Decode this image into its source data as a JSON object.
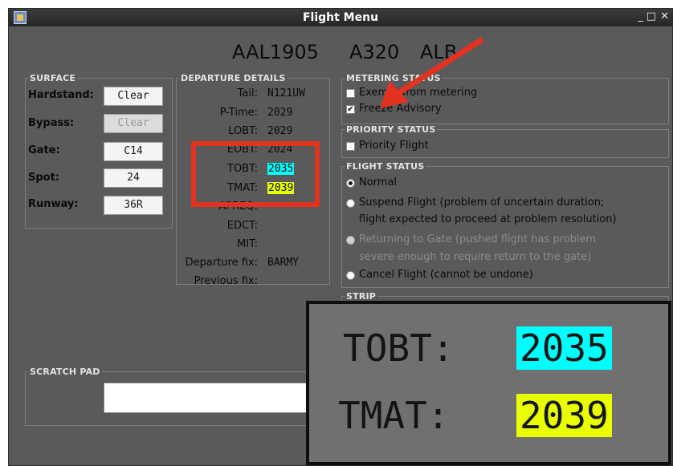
{
  "window": {
    "title": "Flight Menu",
    "minimize": "_",
    "maximize": "□",
    "close": "✕"
  },
  "header": {
    "callsign": "AAL1905",
    "aircraft": "A320",
    "extra": "ALB"
  },
  "surface": {
    "legend": "SURFACE",
    "hardstand_label": "Hardstand:",
    "hardstand_value": "Clear",
    "bypass_label": "Bypass:",
    "bypass_value": "Clear",
    "gate_label": "Gate:",
    "gate_value": "C14",
    "spot_label": "Spot:",
    "spot_value": "24",
    "runway_label": "Runway:",
    "runway_value": "36R"
  },
  "departure": {
    "legend": "DEPARTURE DETAILS",
    "tail_label": "Tail:",
    "tail_value": "N121UW",
    "ptime_label": "P-Time:",
    "ptime_value": "2029",
    "lobt_label": "LOBT:",
    "lobt_value": "2029",
    "eobt_label": "EOBT:",
    "eobt_value": "2024",
    "tobt_label": "TOBT:",
    "tobt_value": "2035",
    "tmat_label": "TMAT:",
    "tmat_value": "2039",
    "apreq_label": "APREQ:",
    "edct_label": "EDCT:",
    "mit_label": "MIT:",
    "depfix_label": "Departure fix:",
    "depfix_value": "BARMY",
    "prevfix_label": "Previous fix:"
  },
  "metering": {
    "legend": "METERING STATUS",
    "exempt_label": "Exempt from metering",
    "freeze_label": "Freeze Advisory",
    "freeze_checked": true
  },
  "priority": {
    "legend": "PRIORITY STATUS",
    "priority_label": "Priority Flight"
  },
  "flight_status": {
    "legend": "FLIGHT STATUS",
    "normal": "Normal",
    "suspend_1": "Suspend Flight (problem of uncertain duration;",
    "suspend_2": "flight expected to proceed at problem resolution)",
    "returning_1": "Returning to Gate (pushed flight has problem",
    "returning_2": "severe enough to require return to the gate)",
    "cancel": "Cancel Flight (cannot be undone)"
  },
  "strip": {
    "legend": "STRIP"
  },
  "scratch": {
    "legend": "SCRATCH PAD",
    "value": ""
  },
  "zoom_inset": {
    "tobt_label": "TOBT:",
    "tobt_value": "2035",
    "tmat_label": "TMAT:",
    "tmat_value": "2039"
  },
  "colors": {
    "highlight_cyan": "#00ffff",
    "highlight_yellow": "#e8ff00",
    "annotation_red": "#e3321f"
  },
  "icons": {
    "window_icon": "app-window-icon",
    "annotation": "red-arrow-icon"
  }
}
